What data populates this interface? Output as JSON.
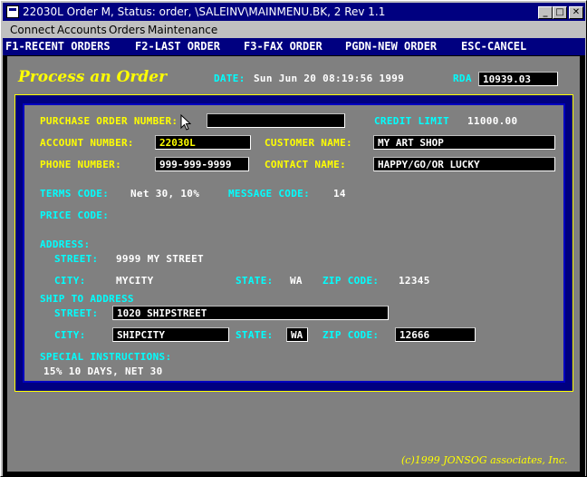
{
  "window": {
    "title": "22030L Order M, Status: order, \\SALEINV\\MAINMENU.BK, 2 Rev 1.1",
    "minimize_glyph": "_",
    "maximize_glyph": "□",
    "close_glyph": "✕"
  },
  "menu": [
    "Connect",
    "Accounts",
    "Orders",
    "Maintenance"
  ],
  "fkeys": [
    "F1-RECENT ORDERS",
    "F2-LAST ORDER",
    "F3-FAX ORDER",
    "PGDN-NEW ORDER",
    "ESC-CANCEL"
  ],
  "header": {
    "title": "Process an Order",
    "date_label": "DATE:",
    "date_value": "Sun Jun 20 08:19:56 1999",
    "rda_label": "RDA",
    "rda_value": "10939.03"
  },
  "form": {
    "po_label": "PURCHASE ORDER NUMBER:",
    "po_value": "",
    "credit_label": "CREDIT LIMIT",
    "credit_value": "11000.00",
    "account_label": "ACCOUNT NUMBER:",
    "account_value": "22030L",
    "customer_label": "CUSTOMER NAME:",
    "customer_value": "MY ART SHOP",
    "phone_label": "PHONE NUMBER:",
    "phone_value": "999-999-9999",
    "contact_label": "CONTACT NAME:",
    "contact_value": "HAPPY/GO/OR LUCKY",
    "terms_label": "TERMS CODE:",
    "terms_value": "Net 30, 10%",
    "message_label": "MESSAGE CODE:",
    "message_value": "14",
    "price_label": "PRICE CODE:",
    "address_label": "ADDRESS:",
    "street_label": "STREET:",
    "street_value": "9999 MY STREET",
    "city_label": "CITY:",
    "city_value": "MYCITY",
    "state_label": "STATE:",
    "state_value": "WA",
    "zip_label": "ZIP CODE:",
    "zip_value": "12345",
    "ship_label": "SHIP TO ADDRESS",
    "ship_street_label": "STREET:",
    "ship_street_value": "1020 SHIPSTREET",
    "ship_city_label": "CITY:",
    "ship_city_value": "SHIPCITY",
    "ship_state_label": "STATE:",
    "ship_state_value": "WA",
    "ship_zip_label": "ZIP CODE:",
    "ship_zip_value": "12666",
    "special_label": "SPECIAL INSTRUCTIONS:",
    "special_value": "15% 10 DAYS, NET 30"
  },
  "footer": "(c)1999 JONSOG associates, Inc."
}
